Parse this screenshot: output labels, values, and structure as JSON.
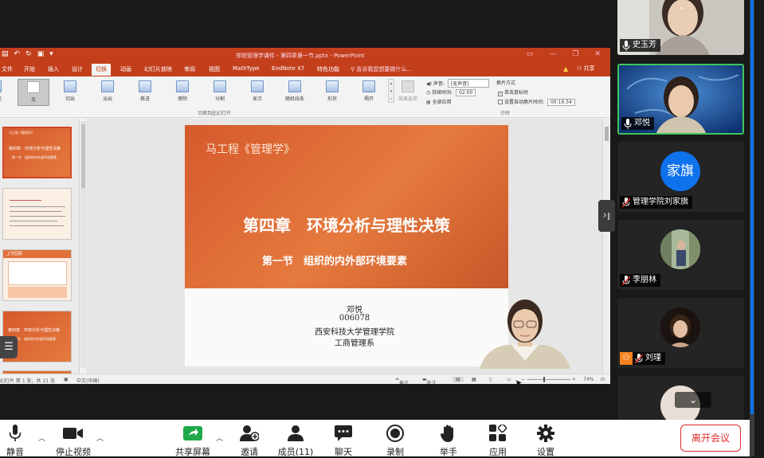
{
  "ppt": {
    "qat": [
      "▤",
      "↶",
      "↻",
      "▣",
      "▾"
    ],
    "window_title": "郑悦管理学课件 - 第四章第一节.pptx - PowerPoint",
    "window_controls": [
      "▭",
      "—",
      "❐",
      "✕"
    ],
    "tabs": [
      "文件",
      "开始",
      "插入",
      "设计",
      "切换",
      "动画",
      "幻灯片放映",
      "审阅",
      "视图",
      "MathType",
      "EndNote X7",
      "特色功能"
    ],
    "active_tab": "切换",
    "tell_me": "告诉我您想要做什么...",
    "share": "共享",
    "preview_label": "预览",
    "transitions": [
      "无",
      "切出",
      "淡出",
      "推进",
      "擦除",
      "分割",
      "显示",
      "随机线条",
      "形状",
      "揭开"
    ],
    "selected_transition": "无",
    "effect_options": "效果选项",
    "group_transitions": "切换到此幻灯片",
    "group_timing": "计时",
    "timing": {
      "sound_label": "声音:",
      "sound_value": "[无声音]",
      "duration_label": "持续时间:",
      "duration_value": "02.00",
      "apply_all": "全部应用",
      "advance_label": "换片方式",
      "on_click": "单击鼠标时",
      "after_label": "设置自动换片时间:",
      "after_value": "00:19.34"
    },
    "thumbnails": [
      {
        "title": "第四章　环境分析与理性决策",
        "sub": "第一节　组织的内外部环境要素",
        "tag": "马工程《管理学》"
      },
      {
        "title": "",
        "sub": "",
        "tag": ""
      },
      {
        "title": "",
        "sub": "",
        "tag": "上节回顾"
      },
      {
        "title": "第四章　环境分析与理性决策",
        "sub": "第一节　组织的内外部环境要素",
        "tag": ""
      }
    ],
    "slide": {
      "brand": "马工程《管理学》",
      "chapter": "第四章　环境分析与理性决策",
      "section": "第一节　组织的内外部环境要素",
      "author": "邓悦",
      "id": "006078",
      "school": "西安科技大学管理学院",
      "dept": "工商管理系"
    },
    "status": {
      "slide_info": "幻灯片 第 1 张，共 21 张",
      "lang": "中文(中国)",
      "notes": "备注",
      "comments": "批注",
      "zoom": "74%"
    }
  },
  "gallery": [
    {
      "name": "史玉芳",
      "muted": false
    },
    {
      "name": "邓悦",
      "muted": false
    },
    {
      "name": "管理学院刘家旗",
      "muted": true,
      "initials": "家旗"
    },
    {
      "name": "李朋林",
      "muted": true
    },
    {
      "name": "刘瑾",
      "muted": true
    }
  ],
  "toolbar": {
    "mute": "静音",
    "stop_video": "停止视频",
    "share_screen": "共享屏幕",
    "invite": "邀请",
    "participants": "成员(11)",
    "chat": "聊天",
    "record": "录制",
    "raise_hand": "举手",
    "apps": "应用",
    "settings": "设置",
    "leave": "离开会议"
  },
  "colors": {
    "ppt_red": "#c33f1c",
    "slide_orange": "#e0703a",
    "zoom_blue": "#0e72ed",
    "leave_red": "#e02828",
    "speaking_green": "#3ec55b"
  }
}
